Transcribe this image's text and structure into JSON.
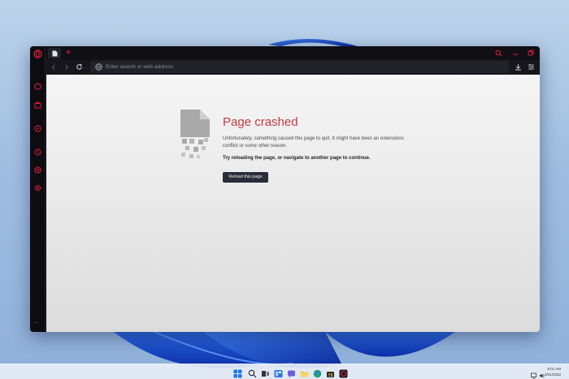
{
  "colors": {
    "accent": "#e11d3b",
    "title_red": "#c43a3f",
    "window_bg": "#101014",
    "button_bg": "#2b2b3a"
  },
  "browser": {
    "tab_icon": "document-icon",
    "new_tab_label": "+",
    "address_placeholder": "Enter search or web address"
  },
  "page": {
    "title": "Page crashed",
    "description": "Unfortunately, something caused this page to quit. It might have been an extensions conflict or some other reason.",
    "hint": "Try reloading the page, or navigate to another page to continue.",
    "reload_button": "Reload this page"
  },
  "sidebar": {
    "items": [
      "opera-logo-icon",
      "messenger-icon",
      "wallet-icon",
      "player-icon",
      "history-icon",
      "crypto-icon",
      "settings-icon"
    ],
    "more_label": "..."
  },
  "taskbar": {
    "icons": [
      "start-icon",
      "search-icon",
      "task-view-icon",
      "widgets-icon",
      "chat-icon",
      "file-explorer-icon",
      "edge-icon",
      "store-icon",
      "opera-gx-icon"
    ],
    "time": "8:01 AM",
    "date": "3/21/2022"
  }
}
